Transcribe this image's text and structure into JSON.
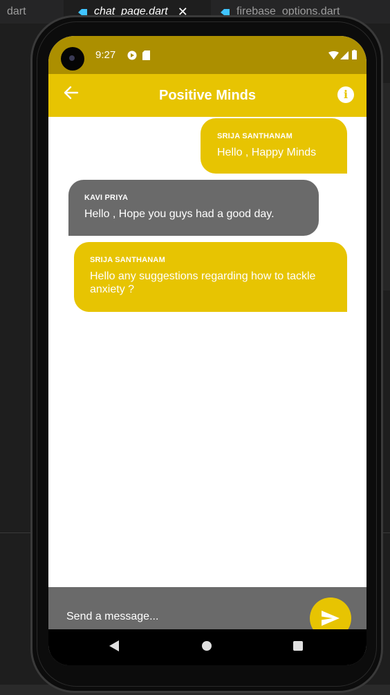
{
  "ide": {
    "tabs": [
      {
        "label": "dart"
      },
      {
        "label": "chat_page.dart",
        "close": "✕"
      },
      {
        "label": "firebase_options.dart"
      }
    ]
  },
  "status_bar": {
    "time": "9:27"
  },
  "app_bar": {
    "title": "Positive Minds"
  },
  "messages": [
    {
      "sender": "SRIJA SANTHANAM",
      "text": "Hello , Happy Minds",
      "side": "right"
    },
    {
      "sender": "KAVI PRIYA",
      "text": "Hello , Hope you guys had a good day.",
      "side": "left"
    },
    {
      "sender": "SRIJA SANTHANAM",
      "text": "Hello any suggestions regarding how to tackle anxiety ?",
      "side": "right"
    }
  ],
  "composer": {
    "placeholder": "Send a message..."
  },
  "colors": {
    "app_bar": "#e7c402",
    "status_bar": "#ac8f00",
    "own_bubble": "#e7c402",
    "other_bubble": "#6a6a6a",
    "composer": "#6a6a6a"
  },
  "icons": {
    "back": "arrow-left-icon",
    "info": "info-icon",
    "send": "send-icon",
    "nav": [
      "nav-back-icon",
      "nav-home-icon",
      "nav-recents-icon"
    ]
  }
}
